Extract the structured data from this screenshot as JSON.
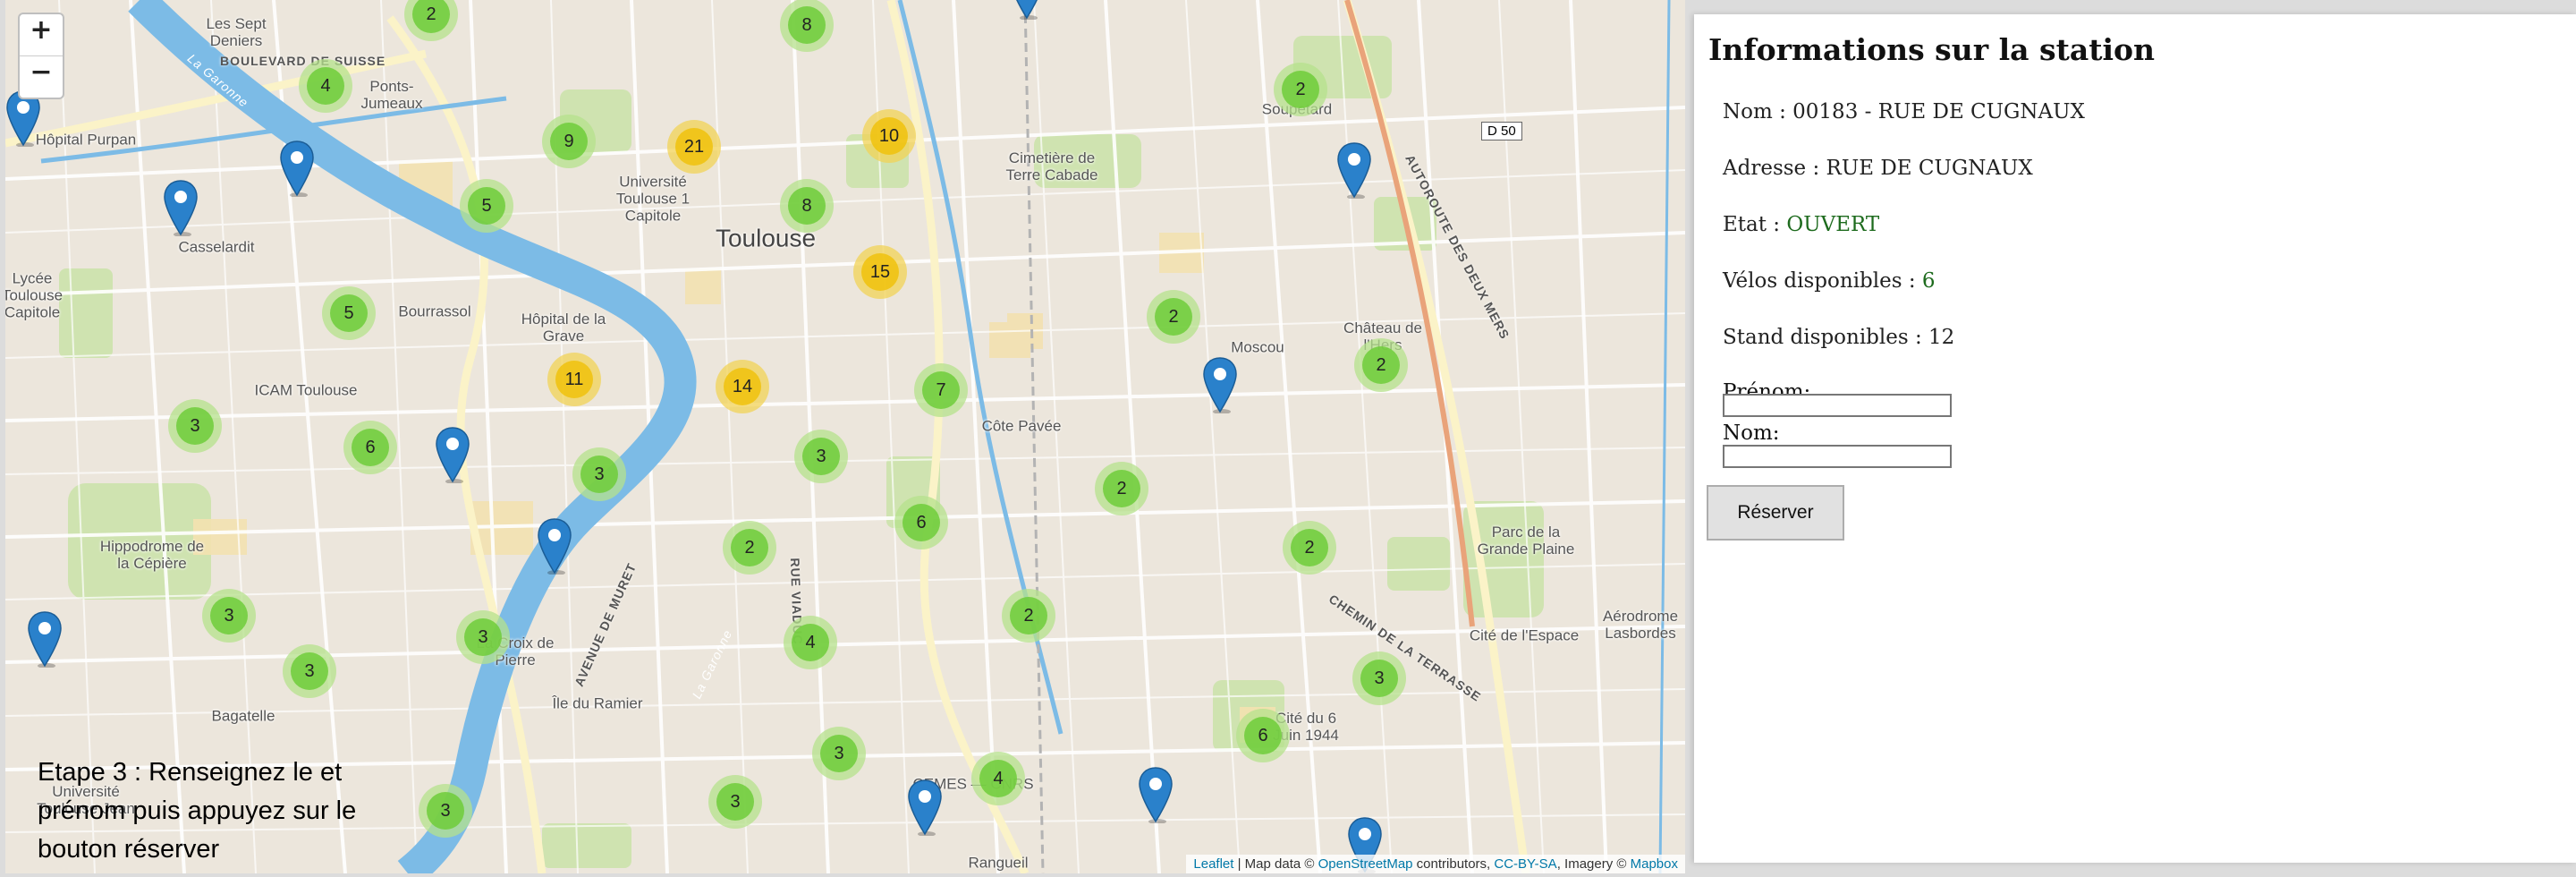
{
  "map": {
    "zoom_in": "+",
    "zoom_out": "−",
    "instruction": "Etape 3 : Renseignez le et prénom puis appuyez sur le bouton réserver",
    "attribution": {
      "leaflet": "Leaflet",
      "sep1": " | Map data © ",
      "osm": "OpenStreetMap",
      "sep2": " contributors, ",
      "cc": "CC-BY-SA",
      "sep3": ", Imagery © ",
      "mapbox": "Mapbox"
    },
    "road_badge": "D 50",
    "places": [
      {
        "label": "Les Sept\nDeniers",
        "cls": ""
      },
      {
        "label": "Ponts-\nJumeaux",
        "cls": ""
      },
      {
        "label": "Hôpital Purpan",
        "cls": ""
      },
      {
        "label": "Casselardit",
        "cls": ""
      },
      {
        "label": "Bourrassol",
        "cls": ""
      },
      {
        "label": "Hôpital de la\nGrave",
        "cls": ""
      },
      {
        "label": "ICAM Toulouse",
        "cls": ""
      },
      {
        "label": "Université\nToulouse 1\nCapitole",
        "cls": ""
      },
      {
        "label": "Toulouse",
        "cls": "city"
      },
      {
        "label": "Cimetière de\nTerre Cabade",
        "cls": ""
      },
      {
        "label": "Soupetard",
        "cls": ""
      },
      {
        "label": "Moscou",
        "cls": ""
      },
      {
        "label": "Château de\nl'Hers",
        "cls": ""
      },
      {
        "label": "Côte Pavée",
        "cls": ""
      },
      {
        "label": "Hippodrome de\nla Cépière",
        "cls": ""
      },
      {
        "label": "La Croix de\nPierre",
        "cls": ""
      },
      {
        "label": "Île du Ramier",
        "cls": ""
      },
      {
        "label": "Bagatelle",
        "cls": ""
      },
      {
        "label": "Université\nToulouse Jean",
        "cls": ""
      },
      {
        "label": "Rangueil",
        "cls": ""
      },
      {
        "label": "Parc de la\nGrande Plaine",
        "cls": ""
      },
      {
        "label": "Cité de l'Espace",
        "cls": ""
      },
      {
        "label": "Aérodrome\nLasbordes",
        "cls": ""
      },
      {
        "label": "Cité du 6\nJuin 1944",
        "cls": ""
      },
      {
        "label": "CEMES — CNRS",
        "cls": ""
      },
      {
        "label": "Lycée\nToulouse\nCapitole",
        "cls": ""
      }
    ],
    "roads": [
      "AVENUE DE MURET",
      "RUE VIADUC",
      "AUTOROUTE DES DEUX MERS",
      "CHEMIN DE LA TERRASSE",
      "BOULEVARD DE SUISSE",
      "La Garonne",
      "La Garonne"
    ],
    "clusters": [
      {
        "n": "2",
        "level": "small"
      },
      {
        "n": "8",
        "level": "small"
      },
      {
        "n": "4",
        "level": "small"
      },
      {
        "n": "9",
        "level": "small"
      },
      {
        "n": "21",
        "level": "medium"
      },
      {
        "n": "10",
        "level": "medium"
      },
      {
        "n": "2",
        "level": "small"
      },
      {
        "n": "5",
        "level": "small"
      },
      {
        "n": "8",
        "level": "small"
      },
      {
        "n": "15",
        "level": "medium"
      },
      {
        "n": "5",
        "level": "small"
      },
      {
        "n": "2",
        "level": "small"
      },
      {
        "n": "2",
        "level": "small"
      },
      {
        "n": "11",
        "level": "medium"
      },
      {
        "n": "14",
        "level": "medium"
      },
      {
        "n": "7",
        "level": "small"
      },
      {
        "n": "3",
        "level": "small"
      },
      {
        "n": "6",
        "level": "small"
      },
      {
        "n": "3",
        "level": "small"
      },
      {
        "n": "3",
        "level": "small"
      },
      {
        "n": "2",
        "level": "small"
      },
      {
        "n": "6",
        "level": "small"
      },
      {
        "n": "2",
        "level": "small"
      },
      {
        "n": "2",
        "level": "small"
      },
      {
        "n": "3",
        "level": "small"
      },
      {
        "n": "3",
        "level": "small"
      },
      {
        "n": "3",
        "level": "small"
      },
      {
        "n": "4",
        "level": "small"
      },
      {
        "n": "2",
        "level": "small"
      },
      {
        "n": "3",
        "level": "small"
      },
      {
        "n": "6",
        "level": "small"
      },
      {
        "n": "3",
        "level": "small"
      },
      {
        "n": "4",
        "level": "small"
      },
      {
        "n": "3",
        "level": "small"
      },
      {
        "n": "3",
        "level": "small"
      }
    ],
    "marker_count": 12,
    "colors": {
      "cluster_small": "#6ecc39",
      "cluster_medium": "#f0c20c",
      "marker": "#2a81cb",
      "river": "#7cbbe6"
    }
  },
  "station": {
    "heading": "Informations sur la station",
    "name_label": "Nom : ",
    "name_value": "00183 - RUE DE CUGNAUX",
    "address_label": "Adresse : ",
    "address_value": "RUE DE CUGNAUX",
    "state_label": "Etat : ",
    "state_value": "OUVERT",
    "bikes_label": "Vélos disponibles : ",
    "bikes_value": "6",
    "stands_label": "Stand disponibles : ",
    "stands_value": "12",
    "state_color": "#1e6b1e"
  },
  "form": {
    "first_name_label": "Prénom:",
    "first_name_value": "",
    "last_name_label": "Nom:",
    "last_name_value": "",
    "reserve_label": "Réserver"
  }
}
